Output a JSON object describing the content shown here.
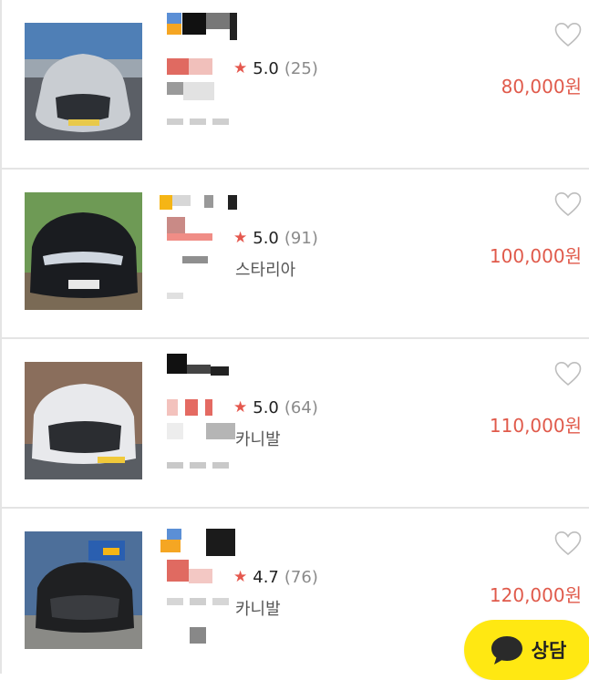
{
  "listings": [
    {
      "rating": "5.0",
      "reviews": "(25)",
      "model": "",
      "price": "80,000원"
    },
    {
      "rating": "5.0",
      "reviews": "(91)",
      "model": "스타리아",
      "price": "100,000원"
    },
    {
      "rating": "5.0",
      "reviews": "(64)",
      "model": "카니발",
      "price": "110,000원"
    },
    {
      "rating": "4.7",
      "reviews": "(76)",
      "model": "카니발",
      "price": "120,000원"
    }
  ],
  "icons": {
    "star": "star-icon",
    "heart": "heart-outline-icon",
    "chat": "chat-bubble-icon"
  },
  "chat_button": {
    "label": "상담"
  },
  "colors": {
    "price": "#e05a4b",
    "star": "#e5584e",
    "chat_button": "#ffe812"
  }
}
